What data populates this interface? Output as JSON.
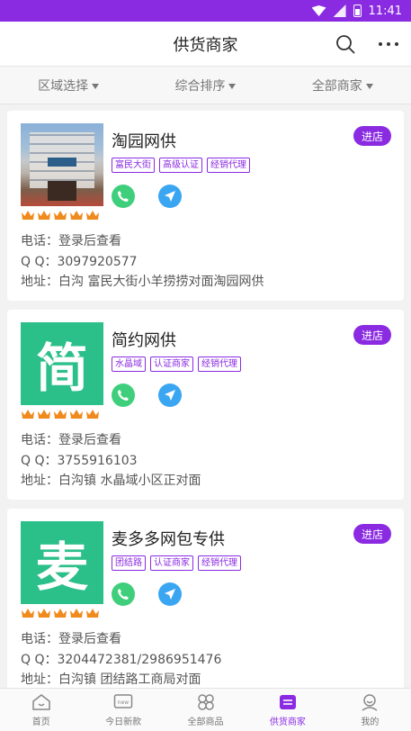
{
  "status": {
    "time": "11:41"
  },
  "header": {
    "title": "供货商家"
  },
  "filters": [
    {
      "label": "区域选择"
    },
    {
      "label": "综合排序"
    },
    {
      "label": "全部商家"
    }
  ],
  "merchants": [
    {
      "name": "淘园网供",
      "thumb_char": "",
      "thumb_color": "",
      "enter_label": "进店",
      "tags": [
        "富民大街",
        "高级认证",
        "经销代理"
      ],
      "phone": "电话：登录后查看",
      "qq": "Q Q：3097920577",
      "address": "地址：白沟 富民大街小羊捞捞对面淘园网供"
    },
    {
      "name": "简约网供",
      "thumb_char": "简",
      "thumb_color": "#2bbf8a",
      "enter_label": "进店",
      "tags": [
        "水晶域",
        "认证商家",
        "经销代理"
      ],
      "phone": "电话：登录后查看",
      "qq": "Q Q：3755916103",
      "address": "地址：白沟镇 水晶域小区正对面"
    },
    {
      "name": "麦多多网包专供",
      "thumb_char": "麦",
      "thumb_color": "#2bbf8a",
      "enter_label": "进店",
      "tags": [
        "团结路",
        "认证商家",
        "经销代理"
      ],
      "phone": "电话：登录后查看",
      "qq": "Q Q：3204472381/2986951476",
      "address": "地址：白沟镇 团结路工商局对面"
    }
  ],
  "tabbar": [
    {
      "label": "首页",
      "icon": "home-icon"
    },
    {
      "label": "今日新款",
      "icon": "new-icon"
    },
    {
      "label": "全部商品",
      "icon": "grid-icon"
    },
    {
      "label": "供货商家",
      "icon": "merchant-icon",
      "active": true
    },
    {
      "label": "我的",
      "icon": "profile-icon"
    }
  ],
  "colors": {
    "accent": "#8a2be2",
    "phone": "#3fcf7c",
    "nav": "#3aa6f2",
    "crown": "#f08a1c"
  }
}
